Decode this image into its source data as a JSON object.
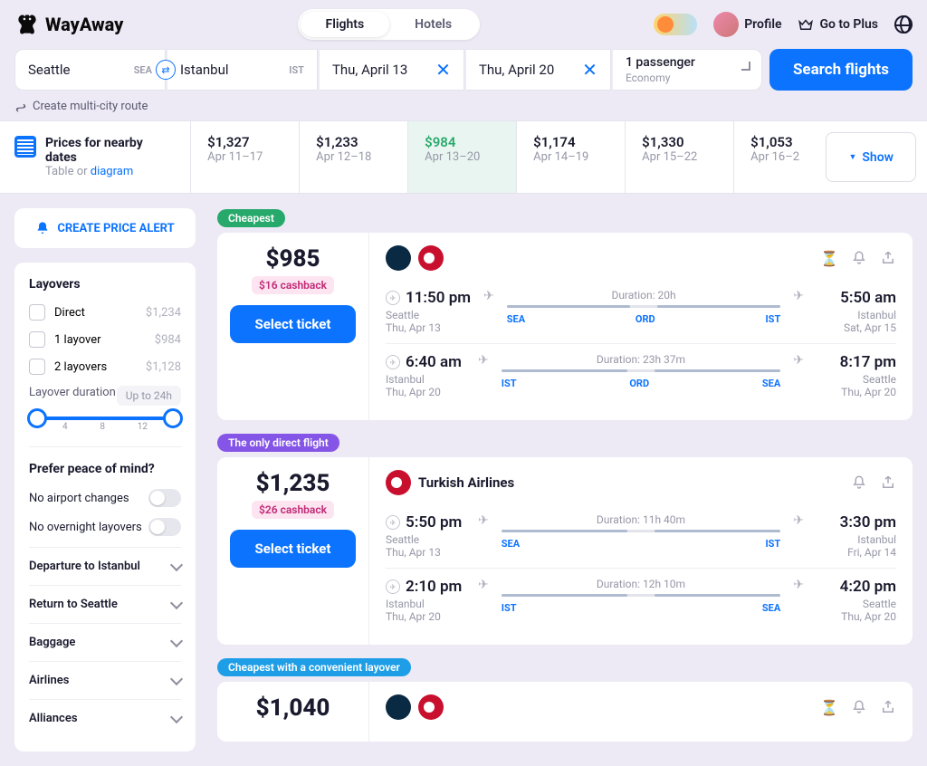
{
  "header": {
    "logo": "WayAway",
    "tabs": {
      "flights": "Flights",
      "hotels": "Hotels"
    },
    "profile": "Profile",
    "plus": "Go to Plus"
  },
  "search": {
    "from": "Seattle",
    "from_code": "SEA",
    "to": "Istanbul",
    "to_code": "IST",
    "date1": "Thu, April 13",
    "date2": "Thu, April 20",
    "passengers": "1 passenger",
    "cabin": "Economy",
    "button": "Search flights",
    "multi_city": "Create multi-city route"
  },
  "dates": {
    "label": "Prices for nearby dates",
    "sub1": "Table or ",
    "sub2": "diagram",
    "cols": [
      {
        "price": "$1,327",
        "range": "Apr 11–17"
      },
      {
        "price": "$1,233",
        "range": "Apr 12–18"
      },
      {
        "price": "$984",
        "range": "Apr 13–20"
      },
      {
        "price": "$1,174",
        "range": "Apr 14–19"
      },
      {
        "price": "$1,330",
        "range": "Apr 15–22"
      },
      {
        "price": "$1,053",
        "range": "Apr 16–2"
      }
    ],
    "show": "Show"
  },
  "sidebar": {
    "alert": "CREATE PRICE ALERT",
    "layovers_title": "Layovers",
    "opts": [
      {
        "label": "Direct",
        "price": "$1,234"
      },
      {
        "label": "1 layover",
        "price": "$984"
      },
      {
        "label": "2 layovers",
        "price": "$1,128"
      }
    ],
    "duration_label": "Layover duration",
    "duration_val": "Up to 24h",
    "marks": [
      "4",
      "8",
      "12"
    ],
    "peace": "Prefer peace of mind?",
    "no_airport": "No airport changes",
    "no_overnight": "No overnight layovers",
    "collapse": [
      "Departure to Istanbul",
      "Return to Seattle",
      "Baggage",
      "Airlines",
      "Alliances"
    ]
  },
  "results": [
    {
      "badge": "Cheapest",
      "badge_cls": "green",
      "price": "$985",
      "cashback": "$16 cashback",
      "select": "Select ticket",
      "airlines": [
        {
          "cls": "al-alaska"
        },
        {
          "cls": "al-turkish"
        }
      ],
      "airline_name": "",
      "hourglass": true,
      "legs": [
        {
          "dep_time": "11:50 pm",
          "dep_city": "Seattle",
          "dep_date": "Thu, Apr 13",
          "duration": "Duration: 20h",
          "codes": [
            "SEA",
            "ORD",
            "IST"
          ],
          "arr_time": "5:50 am",
          "arr_city": "Istanbul",
          "arr_date": "Sat, Apr 15"
        },
        {
          "dep_time": "6:40 am",
          "dep_city": "Istanbul",
          "dep_date": "Thu, Apr 20",
          "duration": "Duration: 23h 37m",
          "codes": [
            "IST",
            "ORD",
            "SEA"
          ],
          "arr_time": "8:17 pm",
          "arr_city": "Seattle",
          "arr_date": "Thu, Apr 20"
        }
      ]
    },
    {
      "badge": "The only direct flight",
      "badge_cls": "purple",
      "price": "$1,235",
      "cashback": "$26 cashback",
      "select": "Select ticket",
      "airlines": [
        {
          "cls": "al-turkish"
        }
      ],
      "airline_name": "Turkish Airlines",
      "hourglass": false,
      "legs": [
        {
          "dep_time": "5:50 pm",
          "dep_city": "Seattle",
          "dep_date": "Thu, Apr 13",
          "duration": "Duration: 11h 40m",
          "codes": [
            "SEA",
            "",
            "IST"
          ],
          "arr_time": "3:30 pm",
          "arr_city": "Istanbul",
          "arr_date": "Fri, Apr 14"
        },
        {
          "dep_time": "2:10 pm",
          "dep_city": "Istanbul",
          "dep_date": "Thu, Apr 20",
          "duration": "Duration: 12h 10m",
          "codes": [
            "IST",
            "",
            "SEA"
          ],
          "arr_time": "4:20 pm",
          "arr_city": "Seattle",
          "arr_date": "Thu, Apr 20"
        }
      ]
    },
    {
      "badge": "Cheapest with a convenient layover",
      "badge_cls": "blue",
      "price": "$1,040",
      "cashback": "",
      "select": "",
      "airlines": [
        {
          "cls": "al-alaska"
        },
        {
          "cls": "al-turkish"
        }
      ],
      "airline_name": "",
      "hourglass": true,
      "legs": []
    }
  ]
}
